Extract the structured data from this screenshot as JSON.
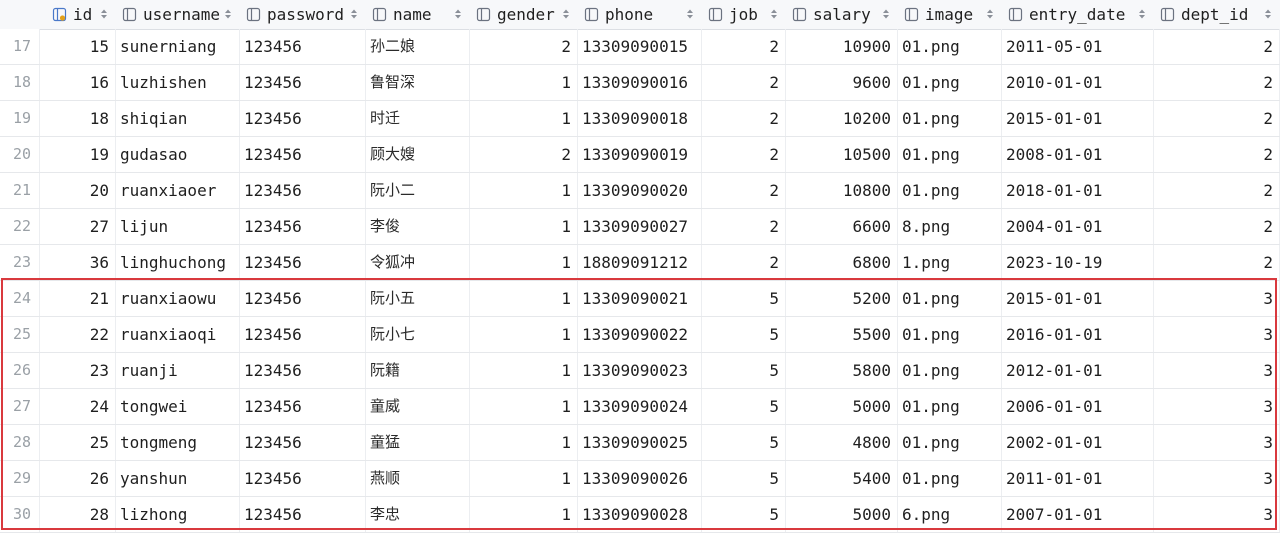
{
  "columns": [
    {
      "key": "id",
      "label": "id",
      "icon": "primary-key-column-icon"
    },
    {
      "key": "username",
      "label": "username",
      "icon": "column-icon"
    },
    {
      "key": "password",
      "label": "password",
      "icon": "column-icon"
    },
    {
      "key": "name",
      "label": "name",
      "icon": "column-icon"
    },
    {
      "key": "gender",
      "label": "gender",
      "icon": "column-icon"
    },
    {
      "key": "phone",
      "label": "phone",
      "icon": "column-icon"
    },
    {
      "key": "job",
      "label": "job",
      "icon": "column-icon"
    },
    {
      "key": "salary",
      "label": "salary",
      "icon": "column-icon"
    },
    {
      "key": "image",
      "label": "image",
      "icon": "column-icon"
    },
    {
      "key": "entry_date",
      "label": "entry_date",
      "icon": "column-icon"
    },
    {
      "key": "dept_id",
      "label": "dept_id",
      "icon": "column-icon"
    }
  ],
  "rows": [
    {
      "rownum": "17",
      "id": "15",
      "username": "sunerniang",
      "password": "123456",
      "name": "孙二娘",
      "gender": "2",
      "phone": "13309090015",
      "job": "2",
      "salary": "10900",
      "image": "01.png",
      "entry_date": "2011-05-01",
      "dept_id": "2"
    },
    {
      "rownum": "18",
      "id": "16",
      "username": "luzhishen",
      "password": "123456",
      "name": "鲁智深",
      "gender": "1",
      "phone": "13309090016",
      "job": "2",
      "salary": "9600",
      "image": "01.png",
      "entry_date": "2010-01-01",
      "dept_id": "2"
    },
    {
      "rownum": "19",
      "id": "18",
      "username": "shiqian",
      "password": "123456",
      "name": "时迁",
      "gender": "1",
      "phone": "13309090018",
      "job": "2",
      "salary": "10200",
      "image": "01.png",
      "entry_date": "2015-01-01",
      "dept_id": "2"
    },
    {
      "rownum": "20",
      "id": "19",
      "username": "gudasao",
      "password": "123456",
      "name": "顾大嫂",
      "gender": "2",
      "phone": "13309090019",
      "job": "2",
      "salary": "10500",
      "image": "01.png",
      "entry_date": "2008-01-01",
      "dept_id": "2"
    },
    {
      "rownum": "21",
      "id": "20",
      "username": "ruanxiaoer",
      "password": "123456",
      "name": "阮小二",
      "gender": "1",
      "phone": "13309090020",
      "job": "2",
      "salary": "10800",
      "image": "01.png",
      "entry_date": "2018-01-01",
      "dept_id": "2"
    },
    {
      "rownum": "22",
      "id": "27",
      "username": "lijun",
      "password": "123456",
      "name": "李俊",
      "gender": "1",
      "phone": "13309090027",
      "job": "2",
      "salary": "6600",
      "image": "8.png",
      "entry_date": "2004-01-01",
      "dept_id": "2"
    },
    {
      "rownum": "23",
      "id": "36",
      "username": "linghuchong",
      "password": "123456",
      "name": "令狐冲",
      "gender": "1",
      "phone": "18809091212",
      "job": "2",
      "salary": "6800",
      "image": "1.png",
      "entry_date": "2023-10-19",
      "dept_id": "2"
    },
    {
      "rownum": "24",
      "id": "21",
      "username": "ruanxiaowu",
      "password": "123456",
      "name": "阮小五",
      "gender": "1",
      "phone": "13309090021",
      "job": "5",
      "salary": "5200",
      "image": "01.png",
      "entry_date": "2015-01-01",
      "dept_id": "3"
    },
    {
      "rownum": "25",
      "id": "22",
      "username": "ruanxiaoqi",
      "password": "123456",
      "name": "阮小七",
      "gender": "1",
      "phone": "13309090022",
      "job": "5",
      "salary": "5500",
      "image": "01.png",
      "entry_date": "2016-01-01",
      "dept_id": "3"
    },
    {
      "rownum": "26",
      "id": "23",
      "username": "ruanji",
      "password": "123456",
      "name": "阮籍",
      "gender": "1",
      "phone": "13309090023",
      "job": "5",
      "salary": "5800",
      "image": "01.png",
      "entry_date": "2012-01-01",
      "dept_id": "3"
    },
    {
      "rownum": "27",
      "id": "24",
      "username": "tongwei",
      "password": "123456",
      "name": "童威",
      "gender": "1",
      "phone": "13309090024",
      "job": "5",
      "salary": "5000",
      "image": "01.png",
      "entry_date": "2006-01-01",
      "dept_id": "3"
    },
    {
      "rownum": "28",
      "id": "25",
      "username": "tongmeng",
      "password": "123456",
      "name": "童猛",
      "gender": "1",
      "phone": "13309090025",
      "job": "5",
      "salary": "4800",
      "image": "01.png",
      "entry_date": "2002-01-01",
      "dept_id": "3"
    },
    {
      "rownum": "29",
      "id": "26",
      "username": "yanshun",
      "password": "123456",
      "name": "燕顺",
      "gender": "1",
      "phone": "13309090026",
      "job": "5",
      "salary": "5400",
      "image": "01.png",
      "entry_date": "2011-01-01",
      "dept_id": "3"
    },
    {
      "rownum": "30",
      "id": "28",
      "username": "lizhong",
      "password": "123456",
      "name": "李忠",
      "gender": "1",
      "phone": "13309090028",
      "job": "5",
      "salary": "5000",
      "image": "6.png",
      "entry_date": "2007-01-01",
      "dept_id": "3"
    }
  ],
  "colors": {
    "highlight_border": "#d9393e",
    "row_number_text": "#9aa0a6",
    "header_background": "#f7f8fa",
    "primary_key_icon": "#4a78c9"
  }
}
